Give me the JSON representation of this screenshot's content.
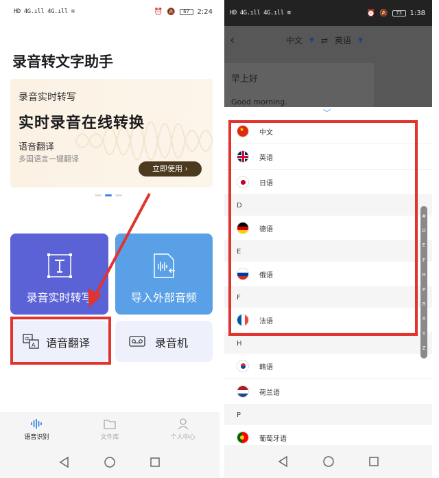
{
  "left": {
    "status": {
      "left": "HD 4G.ıll 4G.ıll ≋",
      "battery": "67",
      "time": "2:24"
    },
    "app_title": "录音转文字助手",
    "banner": {
      "subtitle": "录音实时转写",
      "headline": "实时录音在线转换",
      "line2": "语音翻译",
      "line3": "多国语言一键翻译",
      "button": "立即使用 ›"
    },
    "tiles": [
      {
        "label": "录音实时转写",
        "icon": "text-box-icon"
      },
      {
        "label": "导入外部音频",
        "icon": "import-audio-icon"
      },
      {
        "label": "语音翻译",
        "icon": "translate-icon"
      },
      {
        "label": "录音机",
        "icon": "tape-recorder-icon"
      }
    ],
    "tabs": [
      {
        "label": "语音识别",
        "icon": "waveform-icon"
      },
      {
        "label": "文件库",
        "icon": "folder-icon"
      },
      {
        "label": "个人中心",
        "icon": "person-icon"
      }
    ]
  },
  "right": {
    "status": {
      "left": "HD 4G.ıll 4G.ıll ≋",
      "battery": "73",
      "time": "1:38"
    },
    "header": {
      "source_lang": "中文",
      "swap": "⇄",
      "target_lang": "英语"
    },
    "source_text": "早上好",
    "translated_text": "Good morning.",
    "languages": [
      {
        "type": "lang",
        "label": "中文",
        "flag": "china"
      },
      {
        "type": "lang",
        "label": "英语",
        "flag": "uk"
      },
      {
        "type": "lang",
        "label": "日语",
        "flag": "japan"
      },
      {
        "type": "section",
        "label": "D"
      },
      {
        "type": "lang",
        "label": "德语",
        "flag": "germany"
      },
      {
        "type": "section",
        "label": "E"
      },
      {
        "type": "lang",
        "label": "俄语",
        "flag": "russia"
      },
      {
        "type": "section",
        "label": "F"
      },
      {
        "type": "lang",
        "label": "法语",
        "flag": "france"
      },
      {
        "type": "section",
        "label": "H"
      },
      {
        "type": "lang",
        "label": "韩语",
        "flag": "korea"
      },
      {
        "type": "lang",
        "label": "荷兰语",
        "flag": "netherlands"
      },
      {
        "type": "section",
        "label": "P"
      },
      {
        "type": "lang",
        "label": "葡萄牙语",
        "flag": "portugal"
      }
    ],
    "index_letters": [
      "#",
      "D",
      "E",
      "F",
      "H",
      "P",
      "R",
      "X",
      "Y",
      "Z"
    ]
  },
  "colors": {
    "annotation_red": "#e2332e",
    "tile_purple": "#5a62d6",
    "tile_blue": "#5aa0e6",
    "accent_blue": "#3a86e6",
    "button_brown": "#4b3a1e"
  }
}
